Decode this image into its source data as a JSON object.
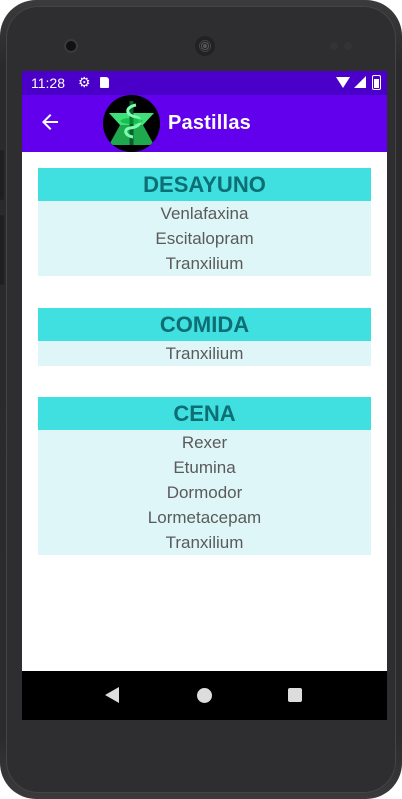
{
  "status_bar": {
    "time": "11:28",
    "icons": [
      "gear-icon",
      "sd-card-icon",
      "wifi-icon",
      "signal-icon",
      "battery-icon"
    ]
  },
  "app_bar": {
    "title": "Pastillas",
    "back_icon": "arrow-back-icon",
    "logo": "pharmacy-caduceus-logo"
  },
  "colors": {
    "status_bar": "#4a00c8",
    "app_bar": "#6200ee",
    "section_header": "#40dfe0",
    "section_header_text": "#0d6e73",
    "section_body": "#dff6f8"
  },
  "sections": [
    {
      "title": "DESAYUNO",
      "items": [
        "Venlafaxina",
        "Escitalopram",
        "Tranxilium"
      ]
    },
    {
      "title": "COMIDA",
      "items": [
        "Tranxilium"
      ]
    },
    {
      "title": "CENA",
      "items": [
        "Rexer",
        "Etumina",
        "Dormodor",
        "Lormetacepam",
        "Tranxilium"
      ]
    }
  ],
  "nav_bar": {
    "icons": [
      "nav-back-icon",
      "nav-home-icon",
      "nav-recents-icon"
    ]
  }
}
